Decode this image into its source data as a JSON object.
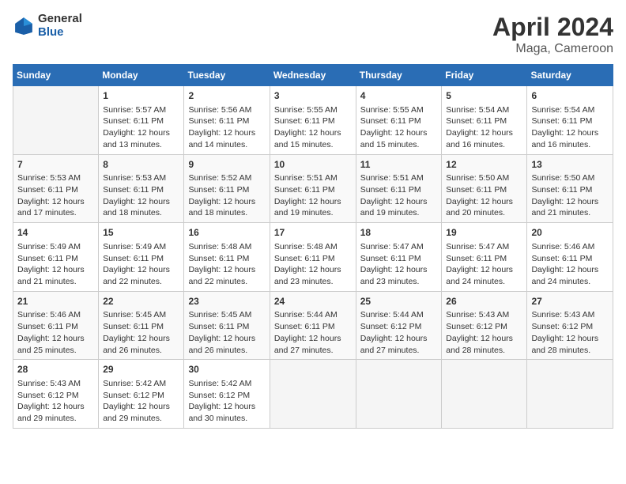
{
  "header": {
    "logo_general": "General",
    "logo_blue": "Blue",
    "month": "April 2024",
    "location": "Maga, Cameroon"
  },
  "columns": [
    "Sunday",
    "Monday",
    "Tuesday",
    "Wednesday",
    "Thursday",
    "Friday",
    "Saturday"
  ],
  "weeks": [
    [
      {
        "day": "",
        "sunrise": "",
        "sunset": "",
        "daylight": ""
      },
      {
        "day": "1",
        "sunrise": "Sunrise: 5:57 AM",
        "sunset": "Sunset: 6:11 PM",
        "daylight": "Daylight: 12 hours and 13 minutes."
      },
      {
        "day": "2",
        "sunrise": "Sunrise: 5:56 AM",
        "sunset": "Sunset: 6:11 PM",
        "daylight": "Daylight: 12 hours and 14 minutes."
      },
      {
        "day": "3",
        "sunrise": "Sunrise: 5:55 AM",
        "sunset": "Sunset: 6:11 PM",
        "daylight": "Daylight: 12 hours and 15 minutes."
      },
      {
        "day": "4",
        "sunrise": "Sunrise: 5:55 AM",
        "sunset": "Sunset: 6:11 PM",
        "daylight": "Daylight: 12 hours and 15 minutes."
      },
      {
        "day": "5",
        "sunrise": "Sunrise: 5:54 AM",
        "sunset": "Sunset: 6:11 PM",
        "daylight": "Daylight: 12 hours and 16 minutes."
      },
      {
        "day": "6",
        "sunrise": "Sunrise: 5:54 AM",
        "sunset": "Sunset: 6:11 PM",
        "daylight": "Daylight: 12 hours and 16 minutes."
      }
    ],
    [
      {
        "day": "7",
        "sunrise": "Sunrise: 5:53 AM",
        "sunset": "Sunset: 6:11 PM",
        "daylight": "Daylight: 12 hours and 17 minutes."
      },
      {
        "day": "8",
        "sunrise": "Sunrise: 5:53 AM",
        "sunset": "Sunset: 6:11 PM",
        "daylight": "Daylight: 12 hours and 18 minutes."
      },
      {
        "day": "9",
        "sunrise": "Sunrise: 5:52 AM",
        "sunset": "Sunset: 6:11 PM",
        "daylight": "Daylight: 12 hours and 18 minutes."
      },
      {
        "day": "10",
        "sunrise": "Sunrise: 5:51 AM",
        "sunset": "Sunset: 6:11 PM",
        "daylight": "Daylight: 12 hours and 19 minutes."
      },
      {
        "day": "11",
        "sunrise": "Sunrise: 5:51 AM",
        "sunset": "Sunset: 6:11 PM",
        "daylight": "Daylight: 12 hours and 19 minutes."
      },
      {
        "day": "12",
        "sunrise": "Sunrise: 5:50 AM",
        "sunset": "Sunset: 6:11 PM",
        "daylight": "Daylight: 12 hours and 20 minutes."
      },
      {
        "day": "13",
        "sunrise": "Sunrise: 5:50 AM",
        "sunset": "Sunset: 6:11 PM",
        "daylight": "Daylight: 12 hours and 21 minutes."
      }
    ],
    [
      {
        "day": "14",
        "sunrise": "Sunrise: 5:49 AM",
        "sunset": "Sunset: 6:11 PM",
        "daylight": "Daylight: 12 hours and 21 minutes."
      },
      {
        "day": "15",
        "sunrise": "Sunrise: 5:49 AM",
        "sunset": "Sunset: 6:11 PM",
        "daylight": "Daylight: 12 hours and 22 minutes."
      },
      {
        "day": "16",
        "sunrise": "Sunrise: 5:48 AM",
        "sunset": "Sunset: 6:11 PM",
        "daylight": "Daylight: 12 hours and 22 minutes."
      },
      {
        "day": "17",
        "sunrise": "Sunrise: 5:48 AM",
        "sunset": "Sunset: 6:11 PM",
        "daylight": "Daylight: 12 hours and 23 minutes."
      },
      {
        "day": "18",
        "sunrise": "Sunrise: 5:47 AM",
        "sunset": "Sunset: 6:11 PM",
        "daylight": "Daylight: 12 hours and 23 minutes."
      },
      {
        "day": "19",
        "sunrise": "Sunrise: 5:47 AM",
        "sunset": "Sunset: 6:11 PM",
        "daylight": "Daylight: 12 hours and 24 minutes."
      },
      {
        "day": "20",
        "sunrise": "Sunrise: 5:46 AM",
        "sunset": "Sunset: 6:11 PM",
        "daylight": "Daylight: 12 hours and 24 minutes."
      }
    ],
    [
      {
        "day": "21",
        "sunrise": "Sunrise: 5:46 AM",
        "sunset": "Sunset: 6:11 PM",
        "daylight": "Daylight: 12 hours and 25 minutes."
      },
      {
        "day": "22",
        "sunrise": "Sunrise: 5:45 AM",
        "sunset": "Sunset: 6:11 PM",
        "daylight": "Daylight: 12 hours and 26 minutes."
      },
      {
        "day": "23",
        "sunrise": "Sunrise: 5:45 AM",
        "sunset": "Sunset: 6:11 PM",
        "daylight": "Daylight: 12 hours and 26 minutes."
      },
      {
        "day": "24",
        "sunrise": "Sunrise: 5:44 AM",
        "sunset": "Sunset: 6:11 PM",
        "daylight": "Daylight: 12 hours and 27 minutes."
      },
      {
        "day": "25",
        "sunrise": "Sunrise: 5:44 AM",
        "sunset": "Sunset: 6:12 PM",
        "daylight": "Daylight: 12 hours and 27 minutes."
      },
      {
        "day": "26",
        "sunrise": "Sunrise: 5:43 AM",
        "sunset": "Sunset: 6:12 PM",
        "daylight": "Daylight: 12 hours and 28 minutes."
      },
      {
        "day": "27",
        "sunrise": "Sunrise: 5:43 AM",
        "sunset": "Sunset: 6:12 PM",
        "daylight": "Daylight: 12 hours and 28 minutes."
      }
    ],
    [
      {
        "day": "28",
        "sunrise": "Sunrise: 5:43 AM",
        "sunset": "Sunset: 6:12 PM",
        "daylight": "Daylight: 12 hours and 29 minutes."
      },
      {
        "day": "29",
        "sunrise": "Sunrise: 5:42 AM",
        "sunset": "Sunset: 6:12 PM",
        "daylight": "Daylight: 12 hours and 29 minutes."
      },
      {
        "day": "30",
        "sunrise": "Sunrise: 5:42 AM",
        "sunset": "Sunset: 6:12 PM",
        "daylight": "Daylight: 12 hours and 30 minutes."
      },
      {
        "day": "",
        "sunrise": "",
        "sunset": "",
        "daylight": ""
      },
      {
        "day": "",
        "sunrise": "",
        "sunset": "",
        "daylight": ""
      },
      {
        "day": "",
        "sunrise": "",
        "sunset": "",
        "daylight": ""
      },
      {
        "day": "",
        "sunrise": "",
        "sunset": "",
        "daylight": ""
      }
    ]
  ]
}
